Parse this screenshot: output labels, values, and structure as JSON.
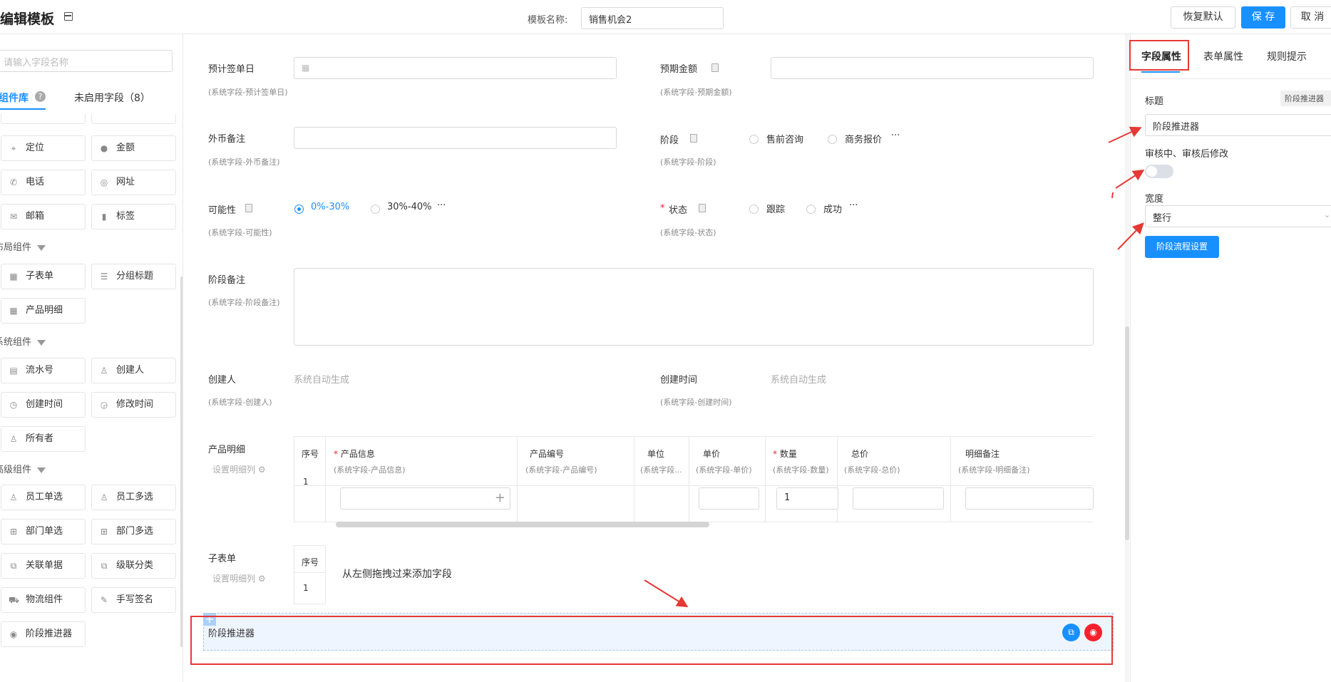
{
  "header": {
    "title": "编辑模板",
    "template_name_label": "模板名称:",
    "template_name_value": "销售机会2",
    "restore_label": "恢复默认",
    "save_label": "保 存",
    "cancel_label": "取 消"
  },
  "left_panel": {
    "search_placeholder": "请输入字段名称",
    "tabs": {
      "library": "组件库",
      "unused": "未启用字段（8）"
    },
    "help": "?",
    "components_top": [
      {
        "label": "定位",
        "icon": "location-icon"
      },
      {
        "label": "金额",
        "icon": "amount-icon"
      },
      {
        "label": "电话",
        "icon": "phone-icon"
      },
      {
        "label": "网址",
        "icon": "globe-icon"
      },
      {
        "label": "邮箱",
        "icon": "mail-icon"
      },
      {
        "label": "标签",
        "icon": "tag-icon"
      }
    ],
    "group_layout": "布局组件",
    "layout_components": [
      {
        "label": "子表单",
        "icon": "table-icon"
      },
      {
        "label": "分组标题",
        "icon": "divider-icon"
      },
      {
        "label": "产品明细",
        "icon": "table-icon"
      }
    ],
    "group_system": "系统组件",
    "system_components": [
      {
        "label": "流水号",
        "icon": "serial-icon"
      },
      {
        "label": "创建人",
        "icon": "user-icon"
      },
      {
        "label": "创建时间",
        "icon": "clock-icon"
      },
      {
        "label": "修改时间",
        "icon": "edit-clock-icon"
      },
      {
        "label": "所有者",
        "icon": "user-icon"
      }
    ],
    "group_advanced": "高级组件",
    "advanced_components": [
      {
        "label": "员工单选",
        "icon": "user-icon"
      },
      {
        "label": "员工多选",
        "icon": "users-icon"
      },
      {
        "label": "部门单选",
        "icon": "org-icon"
      },
      {
        "label": "部门多选",
        "icon": "org-icon"
      },
      {
        "label": "关联单据",
        "icon": "link-doc-icon"
      },
      {
        "label": "级联分类",
        "icon": "cascade-icon"
      },
      {
        "label": "物流组件",
        "icon": "truck-icon"
      },
      {
        "label": "手写签名",
        "icon": "pen-icon"
      },
      {
        "label": "阶段推进器",
        "icon": "stage-icon"
      }
    ]
  },
  "form": {
    "sign_date": {
      "label": "预计签单日",
      "sub": "(系统字段-预计签单日)"
    },
    "amount": {
      "label": "预期金额",
      "sub": "(系统字段-预期金额)"
    },
    "currency_note": {
      "label": "外币备注",
      "sub": "(系统字段-外币备注)"
    },
    "stage": {
      "label": "阶段",
      "sub": "(系统字段-阶段)",
      "opt1": "售前咨询",
      "opt2": "商务报价",
      "more": "···"
    },
    "probability": {
      "label": "可能性",
      "sub": "(系统字段-可能性)",
      "opt1": "0%-30%",
      "opt2": "30%-40%",
      "more": "···"
    },
    "status": {
      "req": "*",
      "label": "状态",
      "sub": "(系统字段-状态)",
      "opt1": "跟踪",
      "opt2": "成功",
      "more": "···"
    },
    "stage_note": {
      "label": "阶段备注",
      "sub": "(系统字段-阶段备注)"
    },
    "creator": {
      "label": "创建人",
      "sub": "(系统字段-创建人)",
      "value": "系统自动生成"
    },
    "created_time": {
      "label": "创建时间",
      "sub": "(系统字段-创建时间)",
      "value": "系统自动生成"
    },
    "product_detail": {
      "label": "产品明细",
      "setup": "设置明细列",
      "columns": [
        {
          "req": "",
          "name": "序号",
          "sub": ""
        },
        {
          "req": "*",
          "name": "产品信息",
          "sub": "(系统字段-产品信息)"
        },
        {
          "req": "",
          "name": "产品编号",
          "sub": "(系统字段-产品编号)"
        },
        {
          "req": "",
          "name": "单位",
          "sub": "(系统字段..."
        },
        {
          "req": "",
          "name": "单价",
          "sub": "(系统字段-单价)"
        },
        {
          "req": "*",
          "name": "数量",
          "sub": "(系统字段-数量)"
        },
        {
          "req": "",
          "name": "总价",
          "sub": "(系统字段-总价)"
        },
        {
          "req": "",
          "name": "明细备注",
          "sub": "(系统字段-明细备注)"
        }
      ],
      "row_index": "1",
      "qty_value": "1",
      "plus": "+"
    },
    "subform": {
      "label": "子表单",
      "setup": "设置明细列",
      "col": "序号",
      "row_index": "1",
      "hint": "从左侧拖拽过来添加字段"
    },
    "stage_advancer": {
      "label": "阶段推进器",
      "plus": "+"
    }
  },
  "right_panel": {
    "tabs": {
      "field": "字段属性",
      "form": "表单属性",
      "rules": "规则提示"
    },
    "title_label": "标题",
    "title_tag": "阶段推进器",
    "title_value": "阶段推进器",
    "review_label": "审核中、审核后修改",
    "review_on": false,
    "width_label": "宽度",
    "width_value": "整行",
    "flow_button": "阶段流程设置"
  },
  "colors": {
    "accent": "#1890ff",
    "annotation": "#e53935",
    "danger": "#f5222d"
  }
}
